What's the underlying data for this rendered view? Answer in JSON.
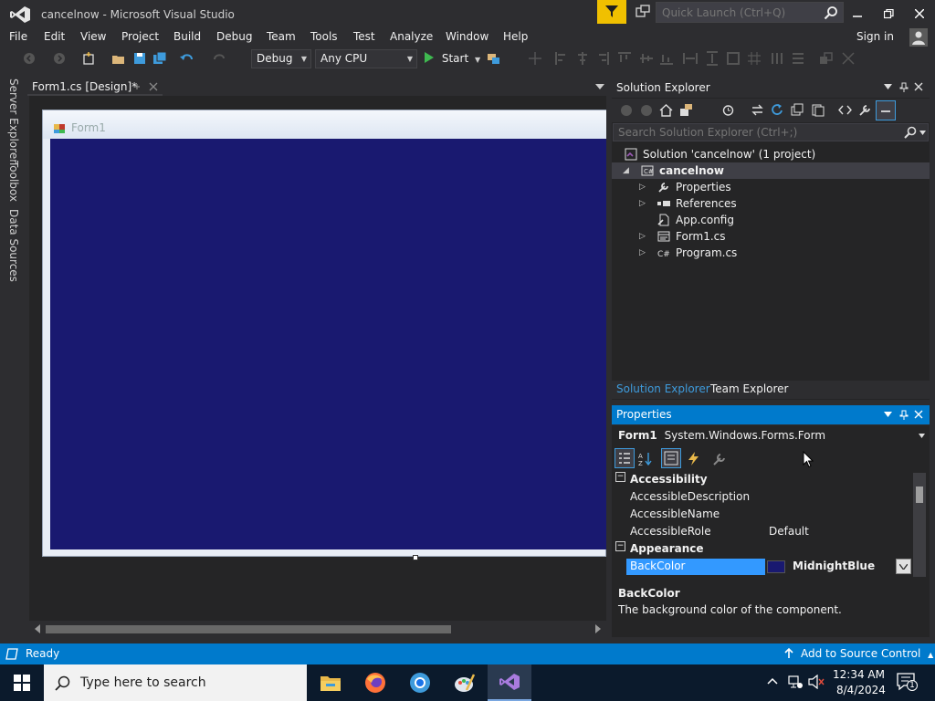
{
  "window": {
    "title": "cancelnow - Microsoft Visual Studio",
    "quick_launch_placeholder": "Quick Launch (Ctrl+Q)",
    "sign_in": "Sign in"
  },
  "menu": [
    "File",
    "Edit",
    "View",
    "Project",
    "Build",
    "Debug",
    "Team",
    "Tools",
    "Test",
    "Analyze",
    "Window",
    "Help"
  ],
  "toolbar": {
    "config": "Debug",
    "platform": "Any CPU",
    "start_label": "Start"
  },
  "side_tabs": [
    "Server Explorer",
    "Toolbox",
    "Data Sources"
  ],
  "document": {
    "tab_label": "Form1.cs [Design]*",
    "form_title": "Form1",
    "form_backcolor": "#191970"
  },
  "solution_explorer": {
    "title": "Solution Explorer",
    "search_placeholder": "Search Solution Explorer (Ctrl+;)",
    "tree": [
      {
        "label": "Solution 'cancelnow' (1 project)",
        "icon": "solution-icon"
      },
      {
        "label": "cancelnow",
        "icon": "csharp-project-icon",
        "expanded": true,
        "selected": true
      },
      {
        "label": "Properties",
        "icon": "wrench-icon"
      },
      {
        "label": "References",
        "icon": "references-icon"
      },
      {
        "label": "App.config",
        "icon": "config-file-icon"
      },
      {
        "label": "Form1.cs",
        "icon": "form-file-icon"
      },
      {
        "label": "Program.cs",
        "icon": "csharp-file-icon"
      }
    ],
    "tabs": [
      "Solution Explorer",
      "Team Explorer"
    ]
  },
  "properties": {
    "title": "Properties",
    "object_name": "Form1",
    "object_type": "System.Windows.Forms.Form",
    "rows": [
      {
        "kind": "category",
        "name": "Accessibility"
      },
      {
        "kind": "prop",
        "name": "AccessibleDescription",
        "value": ""
      },
      {
        "kind": "prop",
        "name": "AccessibleName",
        "value": ""
      },
      {
        "kind": "prop",
        "name": "AccessibleRole",
        "value": "Default"
      },
      {
        "kind": "category",
        "name": "Appearance"
      },
      {
        "kind": "prop",
        "name": "BackColor",
        "value": "MidnightBlue",
        "selected": true
      }
    ],
    "description_title": "BackColor",
    "description_text": "The background color of the component."
  },
  "status": {
    "text": "Ready",
    "source_control": "Add to Source Control"
  },
  "taskbar": {
    "search_placeholder": "Type here to search",
    "time": "12:34 AM",
    "date": "8/4/2024",
    "notification_count": "1"
  },
  "colors": {
    "accent": "#007acc",
    "ide_bg": "#2d2d30",
    "panel_bg": "#252526"
  }
}
